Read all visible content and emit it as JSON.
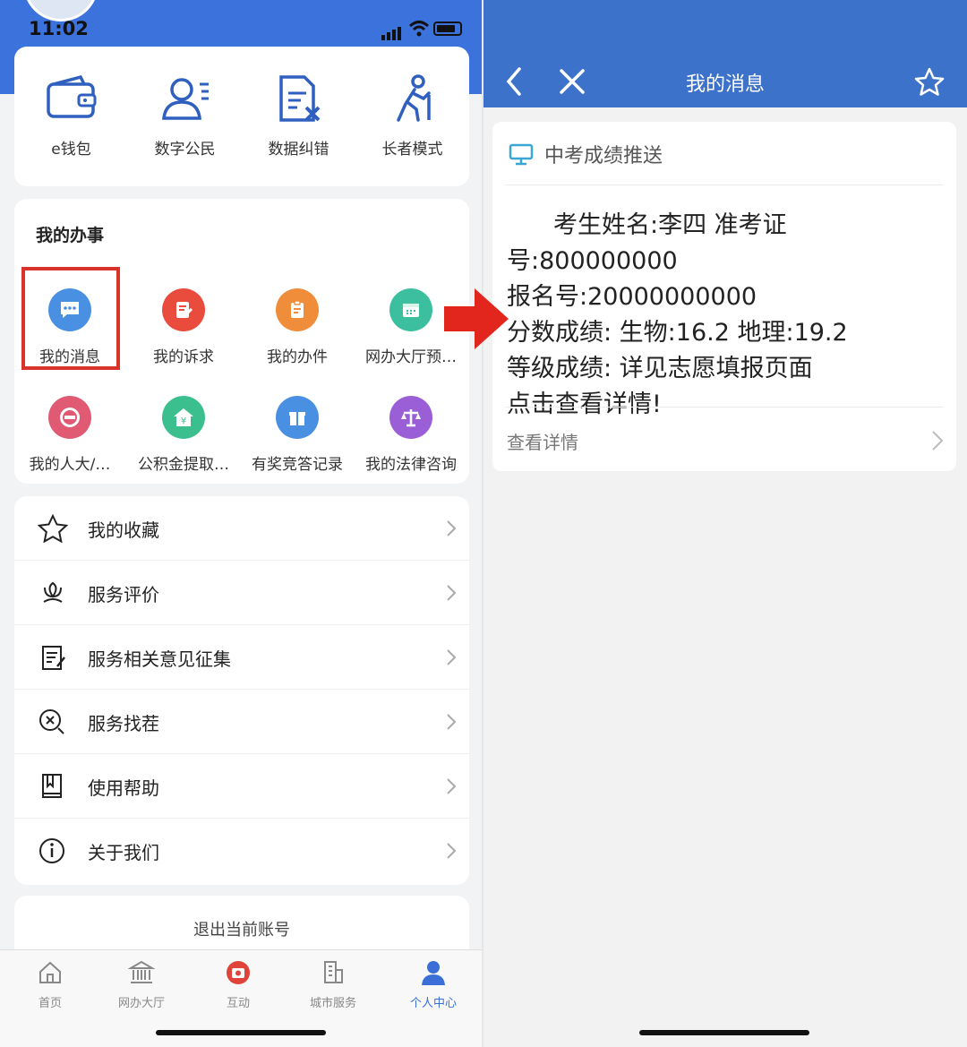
{
  "left_phone": {
    "status_bar": {
      "time": "11:02"
    },
    "quick_actions": [
      {
        "label": "e钱包",
        "icon": "wallet-icon"
      },
      {
        "label": "数字公民",
        "icon": "digital-citizen-icon"
      },
      {
        "label": "数据纠错",
        "icon": "data-correction-icon"
      },
      {
        "label": "长者模式",
        "icon": "elder-mode-icon"
      }
    ],
    "my_tasks": {
      "title": "我的办事",
      "items": [
        {
          "label": "我的消息",
          "icon": "message-icon",
          "color": "#4a90e2"
        },
        {
          "label": "我的诉求",
          "icon": "appeal-icon",
          "color": "#e94b3c"
        },
        {
          "label": "我的办件",
          "icon": "case-icon",
          "color": "#ef8d3b"
        },
        {
          "label": "网办大厅预…",
          "icon": "calendar-icon",
          "color": "#3bbf9f"
        },
        {
          "label": "我的人大/…",
          "icon": "badge-1949-icon",
          "color": "#e05a73"
        },
        {
          "label": "公积金提取…",
          "icon": "housing-fund-icon",
          "color": "#3bbf8e"
        },
        {
          "label": "有奖竞答记录",
          "icon": "gift-icon",
          "color": "#4a90e2"
        },
        {
          "label": "我的法律咨询",
          "icon": "scales-icon",
          "color": "#9a5fd6"
        }
      ]
    },
    "menu": [
      {
        "label": "我的收藏",
        "icon": "star-icon"
      },
      {
        "label": "服务评价",
        "icon": "flower-icon"
      },
      {
        "label": "服务相关意见征集",
        "icon": "note-edit-icon"
      },
      {
        "label": "服务找茬",
        "icon": "search-x-icon"
      },
      {
        "label": "使用帮助",
        "icon": "book-icon"
      },
      {
        "label": "关于我们",
        "icon": "info-icon"
      }
    ],
    "logout_label": "退出当前账号",
    "tabs": [
      {
        "label": "首页",
        "icon": "home-icon"
      },
      {
        "label": "网办大厅",
        "icon": "hall-icon"
      },
      {
        "label": "互动",
        "icon": "camera-icon"
      },
      {
        "label": "城市服务",
        "icon": "city-icon"
      },
      {
        "label": "个人中心",
        "icon": "person-icon",
        "active": true
      }
    ],
    "colors": {
      "header_blue": "#3b72db",
      "highlight_red": "#d9342b",
      "active_tab": "#3a6fd8"
    }
  },
  "right_phone": {
    "nav": {
      "title": "我的消息"
    },
    "message": {
      "category": "中考成绩推送",
      "lines": [
        "考生姓名:李四 准考证号:800000000",
        "报名号:20000000000",
        "分数成绩: 生物:16.2 地理:19.2",
        "等级成绩: 详见志愿填报页面",
        "点击查看详情!"
      ],
      "details_link": "查看详情"
    },
    "colors": {
      "nav_blue": "#3c72c9",
      "arrow_red": "#e3261d"
    }
  }
}
